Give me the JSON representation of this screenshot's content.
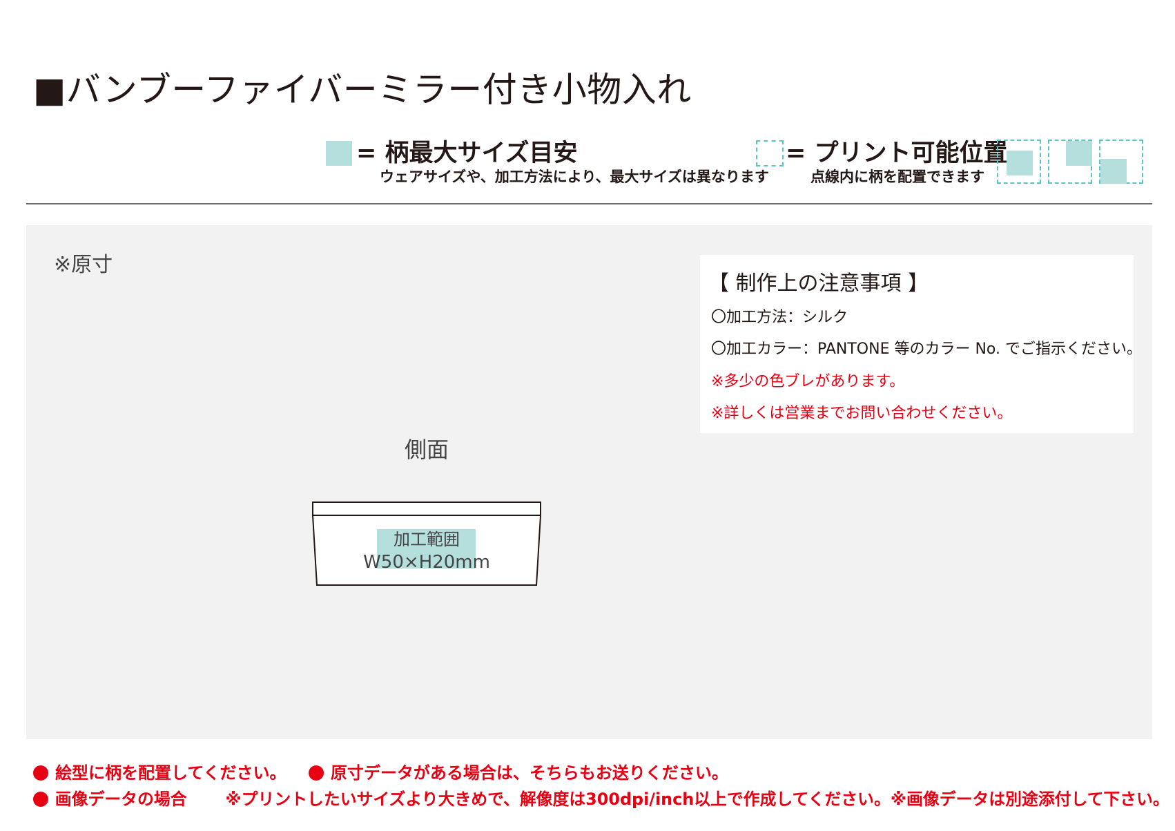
{
  "title": "■バンブーファイバーミラー付き小物入れ",
  "legend": {
    "max_size_label": "= 柄最大サイズ目安",
    "max_size_note": "ウェアサイズや、加工方法により、最大サイズは異なります",
    "printable_label": "= プリント可能位置",
    "printable_note": "点線内に柄を配置できます",
    "swatch_color": "#b4dfdc",
    "dash_color": "#5bc4c4"
  },
  "panel": {
    "scale_note": "※原寸",
    "side_label": "側面",
    "area_label": "加工範囲",
    "area_size": "W50×H20mm"
  },
  "notice": {
    "title": "【 制作上の注意事項 】",
    "method": "〇加工方法：シルク",
    "color": "〇加工カラー：PANTONE 等のカラー No. でご指示ください。",
    "warning1": "※多少の色ブレがあります。",
    "warning2": "※詳しくは営業までお問い合わせください。"
  },
  "footer": {
    "line1a": "絵型に柄を配置してください。",
    "line1b": "原寸データがある場合は、そちらもお送りください。",
    "line2a": "画像データの場合",
    "line2b": "※プリントしたいサイズより大きめで、解像度は300dpi/inch以上で作成してください。※画像データは別途添付して下さい。",
    "accent_color": "#e60012"
  }
}
